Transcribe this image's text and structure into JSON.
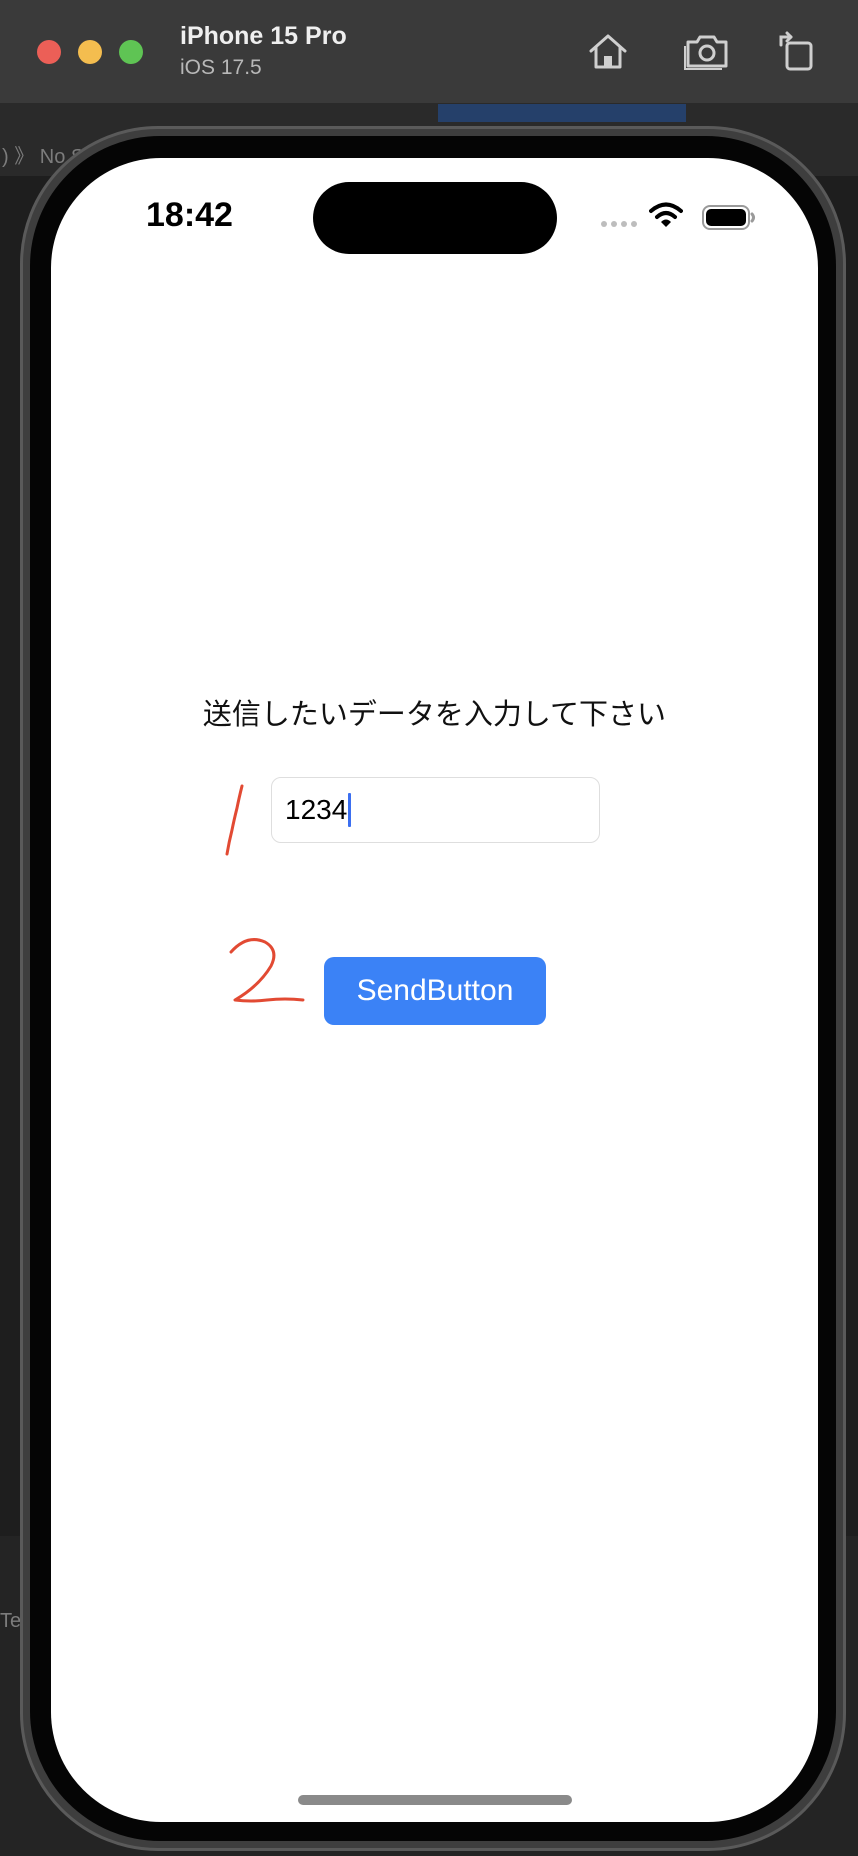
{
  "window": {
    "device_name": "iPhone 15 Pro",
    "os_version": "iOS 17.5",
    "buttons": {
      "home_icon": "home-icon",
      "screenshot_icon": "camera-icon",
      "rotate_icon": "rotate-icon"
    }
  },
  "background": {
    "breadcrumb": ") 》 No S",
    "bottom_text": "Te"
  },
  "status_bar": {
    "time": "18:42"
  },
  "content": {
    "prompt": "送信したいデータを入力して下さい",
    "input_value": "1234",
    "send_button_label": "SendButton"
  },
  "annotations": {
    "mark_1": "1",
    "mark_2": "2",
    "color": "#e24a33"
  },
  "colors": {
    "button": "#3b82f6",
    "caret": "#3b6ff0"
  }
}
